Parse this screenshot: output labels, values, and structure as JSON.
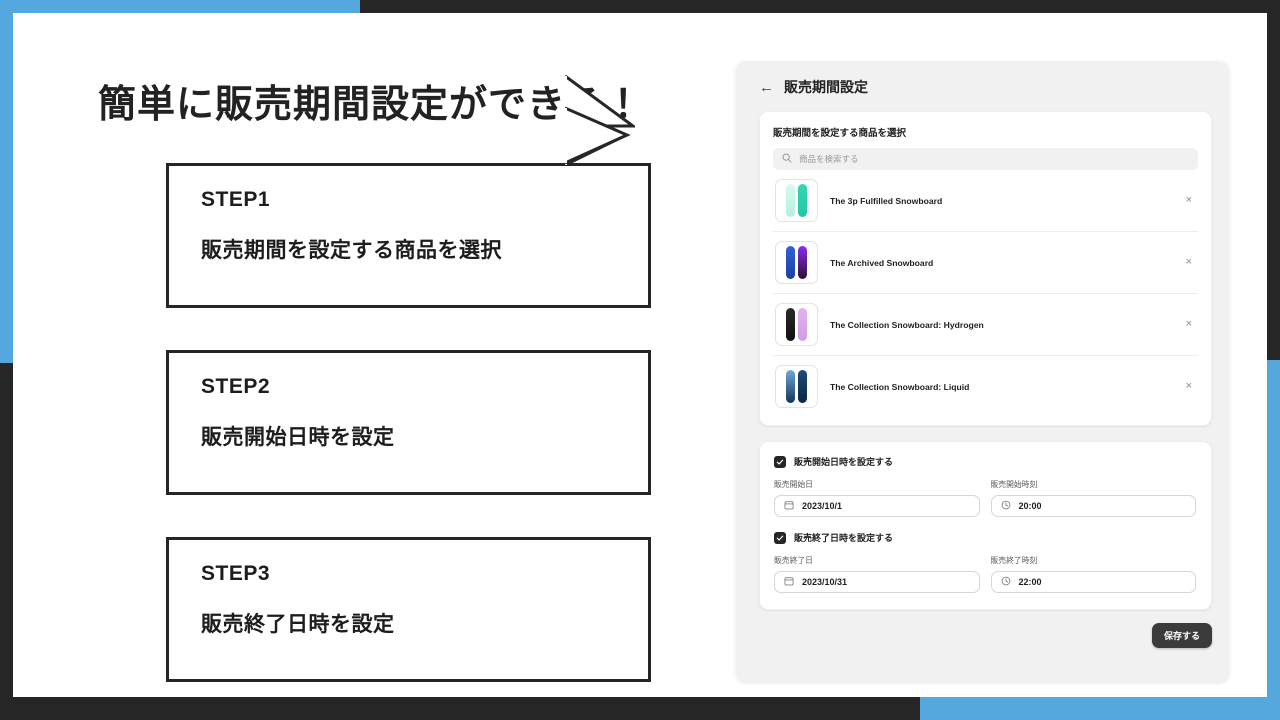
{
  "theme": {
    "accent_blue": "#54a8dd",
    "dark": "#262626",
    "panel_bg": "#f1f1f1",
    "card_bg": "#ffffff"
  },
  "slide": {
    "headline": "簡単に販売期間設定ができる！",
    "steps": [
      {
        "title": "STEP1",
        "desc": "販売期間を設定する商品を選択"
      },
      {
        "title": "STEP2",
        "desc": "販売開始日時を設定"
      },
      {
        "title": "STEP3",
        "desc": "販売終了日時を設定"
      }
    ]
  },
  "app": {
    "back_icon": "←",
    "title": "販売期間設定",
    "products_card": {
      "label": "販売期間を設定する商品を選択",
      "search": {
        "icon": "search-icon",
        "placeholder": "商品を検索する",
        "value": ""
      },
      "items": [
        {
          "name": "The 3p Fulfilled Snowboard",
          "remove_icon": "×",
          "colors": [
            "#b8f0e0",
            "#2ecfb0"
          ]
        },
        {
          "name": "The Archived Snowboard",
          "remove_icon": "×",
          "colors": [
            "#2b4fc9",
            "#8a2be2"
          ]
        },
        {
          "name": "The Collection Snowboard: Hydrogen",
          "remove_icon": "×",
          "colors": [
            "#1c1c1c",
            "#d7a7e8"
          ]
        },
        {
          "name": "The Collection Snowboard: Liquid",
          "remove_icon": "×",
          "colors": [
            "#2f6ea8",
            "#143a63"
          ]
        }
      ]
    },
    "schedule_card": {
      "start": {
        "checkbox_label": "販売開始日時を設定する",
        "checked": true,
        "date_label": "販売開始日",
        "date_value": "2023/10/1",
        "date_icon": "calendar-icon",
        "time_label": "販売開始時刻",
        "time_value": "20:00",
        "time_icon": "clock-icon"
      },
      "end": {
        "checkbox_label": "販売終了日時を設定する",
        "checked": true,
        "date_label": "販売終了日",
        "date_value": "2023/10/31",
        "date_icon": "calendar-icon",
        "time_label": "販売終了時刻",
        "time_value": "22:00",
        "time_icon": "clock-icon"
      }
    },
    "save_label": "保存する"
  }
}
